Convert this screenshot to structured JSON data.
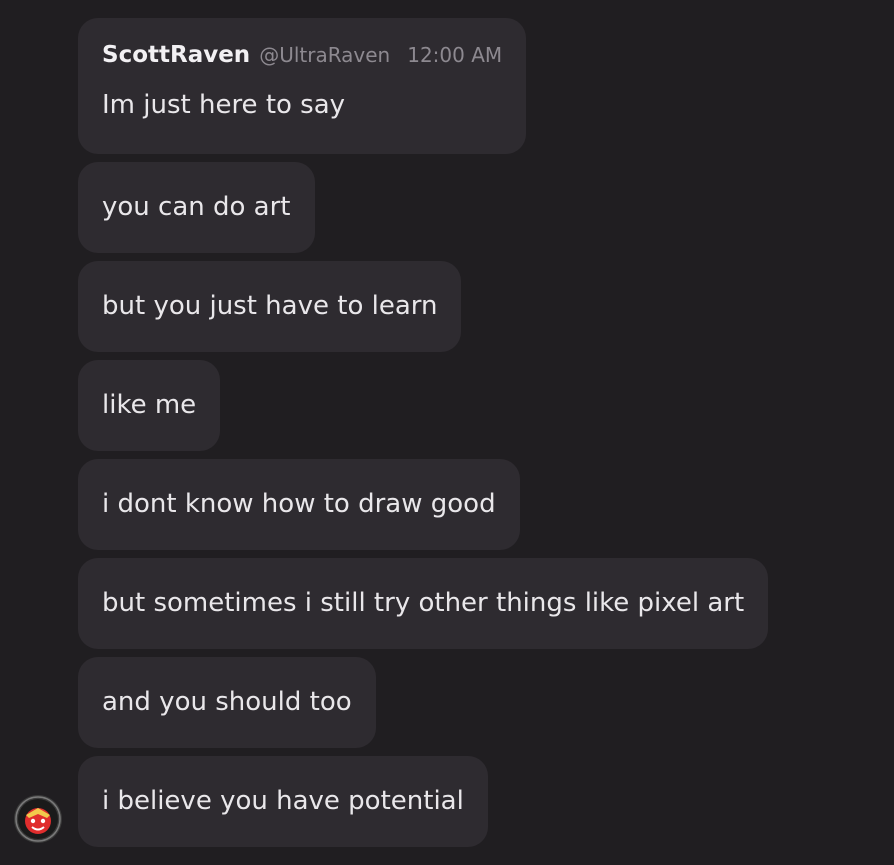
{
  "message_group": {
    "author": "ScottRaven",
    "handle": "@UltraRaven",
    "timestamp": "12:00 AM",
    "messages": [
      "Im just here to say",
      "you can do art",
      "but you just have to learn",
      "like me",
      "i dont know how to draw good",
      "but sometimes i still try other things like pixel art",
      "and you should too",
      "i believe you have potential"
    ]
  },
  "avatar": {
    "icon": "raven-logo-avatar-icon",
    "colors": {
      "ring": "#3a3a3a",
      "face": "#e02d2d",
      "accent": "#f2c94c"
    }
  }
}
